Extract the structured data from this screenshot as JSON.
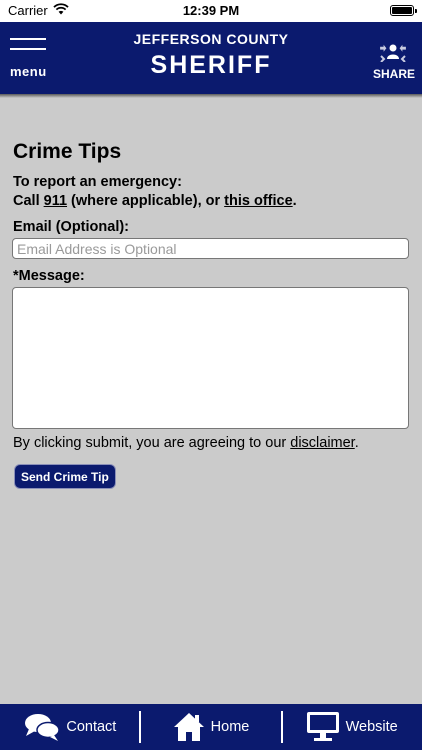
{
  "status_bar": {
    "carrier": "Carrier",
    "time": "12:39 PM"
  },
  "header": {
    "menu_label": "menu",
    "title_small": "JEFFERSON COUNTY",
    "title_big": "SHERIFF",
    "share_label": "SHARE",
    "background_color": "#0b1a6e"
  },
  "form": {
    "title": "Crime Tips",
    "report_line1": "To report an emergency:",
    "report_call": "Call ",
    "report_911": "911",
    "report_mid": " (where applicable), or ",
    "report_office": "this office",
    "report_end": ".",
    "email_label": "Email (Optional):",
    "email_placeholder": "Email Address is Optional",
    "email_value": "",
    "message_label": "*Message:",
    "message_value": "",
    "disclaimer_prefix": "By clicking submit, you are agreeing to our ",
    "disclaimer_link": "disclaimer",
    "disclaimer_suffix": ".",
    "submit_label": "Send Crime Tip"
  },
  "bottom_nav": {
    "items": [
      {
        "label": "Contact",
        "icon": "chat-bubbles-icon"
      },
      {
        "label": "Home",
        "icon": "home-icon"
      },
      {
        "label": "Website",
        "icon": "monitor-icon"
      }
    ]
  }
}
